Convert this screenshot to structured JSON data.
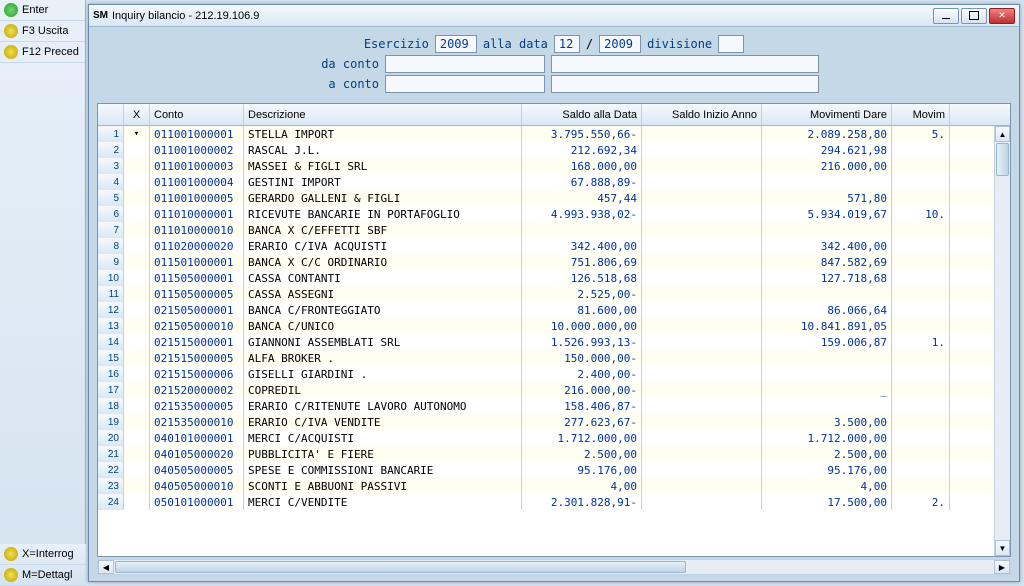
{
  "sidebar": {
    "btn_enter": "Enter",
    "btn_f3": "F3  Uscita",
    "btn_f12": "F12 Preced",
    "btn_x": "X=Interrog",
    "btn_m": "M=Dettagl"
  },
  "window": {
    "title": "Inquiry bilancio   -  212.19.106.9"
  },
  "filter": {
    "esercizio_label": "Esercizio",
    "esercizio_value": "2009",
    "alla_data_label": "alla data",
    "month_value": "12",
    "sep": "/",
    "year_value": "2009",
    "divisione_label": "divisione",
    "divisione_value": "",
    "da_conto_label": "da conto",
    "a_conto_label": "a conto"
  },
  "grid": {
    "headers": {
      "x": "X",
      "conto": "Conto",
      "desc": "Descrizione",
      "saldo": "Saldo alla Data",
      "inizio": "Saldo Inizio Anno",
      "dare": "Movimenti Dare",
      "avere": "Movim"
    },
    "rows": [
      {
        "rn": "1",
        "x": "arrow",
        "conto": "011001000001",
        "desc": "STELLA IMPORT",
        "saldo": "3.795.550,66-",
        "inizio": "",
        "dare": "2.089.258,80",
        "avere": "5."
      },
      {
        "rn": "2",
        "x": "",
        "conto": "011001000002",
        "desc": "RASCAL J.L.",
        "saldo": "212.692,34",
        "inizio": "",
        "dare": "294.621,98",
        "avere": ""
      },
      {
        "rn": "3",
        "x": "",
        "conto": "011001000003",
        "desc": "MASSEI & FIGLI SRL",
        "saldo": "168.000,00",
        "inizio": "",
        "dare": "216.000,00",
        "avere": ""
      },
      {
        "rn": "4",
        "x": "",
        "conto": "011001000004",
        "desc": "GESTINI IMPORT",
        "saldo": "67.888,89-",
        "inizio": "",
        "dare": "",
        "avere": ""
      },
      {
        "rn": "5",
        "x": "",
        "conto": "011001000005",
        "desc": "GERARDO GALLENI & FIGLI",
        "saldo": "457,44",
        "inizio": "",
        "dare": "571,80",
        "avere": ""
      },
      {
        "rn": "6",
        "x": "",
        "conto": "011010000001",
        "desc": "RICEVUTE BANCARIE IN PORTAFOGLIO",
        "saldo": "4.993.938,02-",
        "inizio": "",
        "dare": "5.934.019,67",
        "avere": "10."
      },
      {
        "rn": "7",
        "x": "",
        "conto": "011010000010",
        "desc": "BANCA X C/EFFETTI SBF",
        "saldo": "",
        "inizio": "",
        "dare": "",
        "avere": ""
      },
      {
        "rn": "8",
        "x": "",
        "conto": "011020000020",
        "desc": "ERARIO C/IVA ACQUISTI",
        "saldo": "342.400,00",
        "inizio": "",
        "dare": "342.400,00",
        "avere": ""
      },
      {
        "rn": "9",
        "x": "",
        "conto": "011501000001",
        "desc": "BANCA X C/C ORDINARIO",
        "saldo": "751.806,69",
        "inizio": "",
        "dare": "847.582,69",
        "avere": ""
      },
      {
        "rn": "10",
        "x": "",
        "conto": "011505000001",
        "desc": "CASSA CONTANTI",
        "saldo": "126.518,68",
        "inizio": "",
        "dare": "127.718,68",
        "avere": ""
      },
      {
        "rn": "11",
        "x": "",
        "conto": "011505000005",
        "desc": "CASSA ASSEGNI",
        "saldo": "2.525,00-",
        "inizio": "",
        "dare": "",
        "avere": ""
      },
      {
        "rn": "12",
        "x": "",
        "conto": "021505000001",
        "desc": "BANCA C/FRONTEGGIATO",
        "saldo": "81.600,00",
        "inizio": "",
        "dare": "86.066,64",
        "avere": ""
      },
      {
        "rn": "13",
        "x": "",
        "conto": "021505000010",
        "desc": "BANCA C/UNICO",
        "saldo": "10.000.000,00",
        "inizio": "",
        "dare": "10.841.891,05",
        "avere": ""
      },
      {
        "rn": "14",
        "x": "",
        "conto": "021515000001",
        "desc": "GIANNONI ASSEMBLATI SRL",
        "saldo": "1.526.993,13-",
        "inizio": "",
        "dare": "159.006,87",
        "avere": "1."
      },
      {
        "rn": "15",
        "x": "",
        "conto": "021515000005",
        "desc": "ALFA BROKER .",
        "saldo": "150.000,00-",
        "inizio": "",
        "dare": "",
        "avere": ""
      },
      {
        "rn": "16",
        "x": "",
        "conto": "021515000006",
        "desc": "GISELLI GIARDINI .",
        "saldo": "2.400,00-",
        "inizio": "",
        "dare": "",
        "avere": ""
      },
      {
        "rn": "17",
        "x": "",
        "conto": "021520000002",
        "desc": "COPREDIL",
        "saldo": "216.000,00-",
        "inizio": "",
        "dare": "_",
        "avere": ""
      },
      {
        "rn": "18",
        "x": "",
        "conto": "021535000005",
        "desc": "ERARIO C/RITENUTE LAVORO AUTONOMO",
        "saldo": "158.406,87-",
        "inizio": "",
        "dare": "",
        "avere": ""
      },
      {
        "rn": "19",
        "x": "",
        "conto": "021535000010",
        "desc": "ERARIO C/IVA VENDITE",
        "saldo": "277.623,67-",
        "inizio": "",
        "dare": "3.500,00",
        "avere": ""
      },
      {
        "rn": "20",
        "x": "",
        "conto": "040101000001",
        "desc": "MERCI C/ACQUISTI",
        "saldo": "1.712.000,00",
        "inizio": "",
        "dare": "1.712.000,00",
        "avere": ""
      },
      {
        "rn": "21",
        "x": "",
        "conto": "040105000020",
        "desc": "PUBBLICITA' E FIERE",
        "saldo": "2.500,00",
        "inizio": "",
        "dare": "2.500,00",
        "avere": ""
      },
      {
        "rn": "22",
        "x": "",
        "conto": "040505000005",
        "desc": "SPESE E COMMISSIONI BANCARIE",
        "saldo": "95.176,00",
        "inizio": "",
        "dare": "95.176,00",
        "avere": ""
      },
      {
        "rn": "23",
        "x": "",
        "conto": "040505000010",
        "desc": "SCONTI E ABBUONI PASSIVI",
        "saldo": "4,00",
        "inizio": "",
        "dare": "4,00",
        "avere": ""
      },
      {
        "rn": "24",
        "x": "",
        "conto": "050101000001",
        "desc": "MERCI C/VENDITE",
        "saldo": "2.301.828,91-",
        "inizio": "",
        "dare": "17.500,00",
        "avere": "2."
      }
    ]
  }
}
